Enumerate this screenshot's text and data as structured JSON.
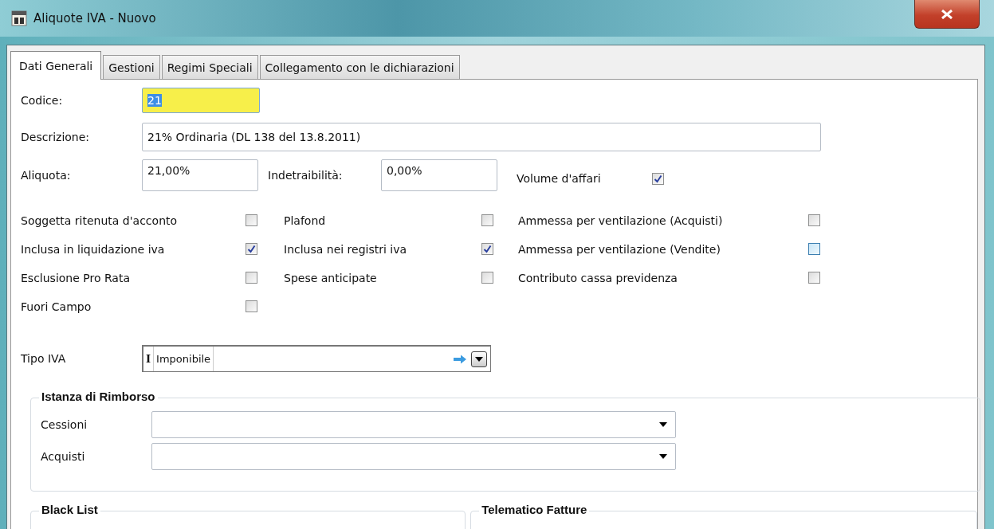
{
  "window": {
    "title": "Aliquote IVA - Nuovo"
  },
  "tabs": [
    {
      "label": "Dati Generali",
      "selected": true
    },
    {
      "label": "Gestioni",
      "selected": false
    },
    {
      "label": "Regimi Speciali",
      "selected": false
    },
    {
      "label": "Collegamento con le dichiarazioni",
      "selected": false
    }
  ],
  "codice": {
    "label": "Codice:",
    "value": "21",
    "focused": true
  },
  "descrizione": {
    "label": "Descrizione:",
    "value": "21% Ordinaria (DL 138 del 13.8.2011)"
  },
  "aliquota": {
    "label": "Aliquota:",
    "value": "21,00%"
  },
  "indetraibilita": {
    "label": "Indetraibilità:",
    "value": "0,00%"
  },
  "volume_affari": {
    "label": "Volume d'affari",
    "checked": true
  },
  "checkboxes": [
    {
      "label": "Soggetta ritenuta d'acconto",
      "checked": false,
      "hover": false
    },
    {
      "label": "Plafond",
      "checked": false,
      "hover": false
    },
    {
      "label": "Ammessa per ventilazione (Acquisti)",
      "checked": false,
      "hover": false
    },
    {
      "label": "Inclusa in liquidazione iva",
      "checked": true,
      "hover": false
    },
    {
      "label": "Inclusa nei registri iva",
      "checked": true,
      "hover": false
    },
    {
      "label": "Ammessa per ventilazione (Vendite)",
      "checked": false,
      "hover": true
    },
    {
      "label": "Esclusione Pro Rata",
      "checked": false,
      "hover": false
    },
    {
      "label": "Spese anticipate",
      "checked": false,
      "hover": false
    },
    {
      "label": "Contributo cassa previdenza",
      "checked": false,
      "hover": false
    },
    {
      "label": "Fuori Campo",
      "checked": false,
      "hover": false
    }
  ],
  "tipo_iva": {
    "label": "Tipo IVA",
    "code": "I",
    "value": "Imponibile"
  },
  "istanza_di_rimborso": {
    "title": "Istanza di Rimborso",
    "fields": [
      {
        "label": "Cessioni"
      },
      {
        "label": "Acquisti"
      }
    ]
  },
  "groups": [
    {
      "title": "Black List"
    },
    {
      "title": "Telematico Fatture"
    }
  ]
}
